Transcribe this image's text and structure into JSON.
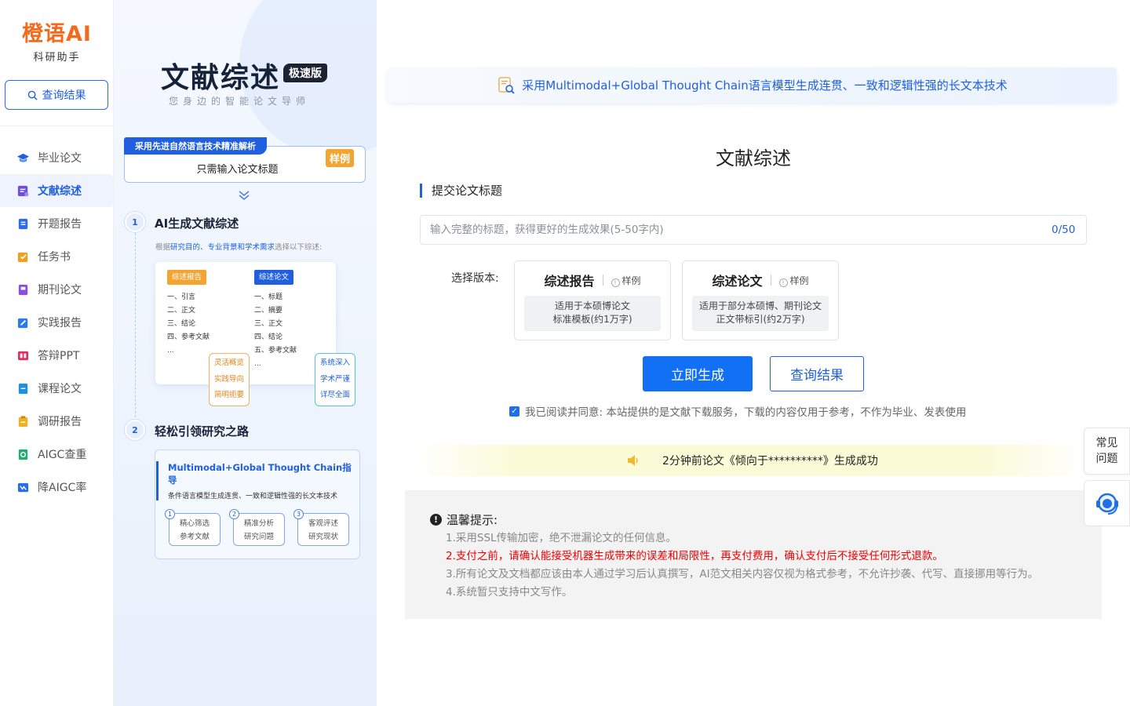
{
  "brand": {
    "name": "橙语AI",
    "tagline": "科研助手"
  },
  "sidebar": {
    "query_label": "查询结果",
    "items": [
      {
        "label": "毕业论文",
        "icon": "graduation-cap-icon",
        "color": "#1f5fe0"
      },
      {
        "label": "文献综述",
        "icon": "document-icon",
        "color": "#6b4fe0",
        "active": true
      },
      {
        "label": "开题报告",
        "icon": "report-icon",
        "color": "#2a6bf0"
      },
      {
        "label": "任务书",
        "icon": "task-icon",
        "color": "#f0a020"
      },
      {
        "label": "期刊论文",
        "icon": "journal-icon",
        "color": "#8a4fe0"
      },
      {
        "label": "实践报告",
        "icon": "practice-icon",
        "color": "#2a7bf0"
      },
      {
        "label": "答辩PPT",
        "icon": "ppt-icon",
        "color": "#e0305f"
      },
      {
        "label": "课程论文",
        "icon": "course-icon",
        "color": "#1f8fe0"
      },
      {
        "label": "调研报告",
        "icon": "survey-icon",
        "color": "#f0b020"
      },
      {
        "label": "AIGC查重",
        "icon": "aigc-check-icon",
        "color": "#1fae70"
      },
      {
        "label": "降AIGC率",
        "icon": "aigc-reduce-icon",
        "color": "#2a6bf0"
      }
    ]
  },
  "promo": {
    "title": "文献综述",
    "badge": "极速版",
    "subtitle": "您身边的智能论文导师",
    "input_tag": "采用先进自然语言技术精准解析",
    "input_text": "只需输入论文标题",
    "sample_tag": "样例",
    "step1": {
      "num": "1",
      "title": "AI生成文献综述",
      "desc_prefix": "根据",
      "desc_highlight": "研究目的、专业背景和学术需求",
      "desc_suffix": "选择以下综述:",
      "left_tag": "综述报告",
      "left_items": [
        "一、引言",
        "二、正文",
        "三、结论",
        "四、参考文献",
        "..."
      ],
      "right_tag": "综述论文",
      "right_items": [
        "一、标题",
        "二、摘要",
        "三、正文",
        "四、结论",
        "五、参考文献",
        "..."
      ],
      "left_features": [
        "灵活概览",
        "实践导向",
        "简明扼要"
      ],
      "right_features": [
        "系统深入",
        "学术严谨",
        "详尽全面"
      ]
    },
    "step2": {
      "num": "2",
      "title": "轻松引领研究之路",
      "card_title": "Multimodal+Global Thought Chain指导",
      "card_sub": "条件语言模型生成连贯、一致和逻辑性强的长文本技术",
      "pills": [
        {
          "num": "1",
          "line1": "精心筛选",
          "line2": "参考文献"
        },
        {
          "num": "2",
          "line1": "精准分析",
          "line2": "研究问题"
        },
        {
          "num": "3",
          "line1": "客观评述",
          "line2": "研究现状"
        }
      ]
    }
  },
  "main": {
    "banner": "采用Multimodal+Global Thought Chain语言模型生成连贯、一致和逻辑性强的长文本技术",
    "title": "文献综述",
    "section_label": "提交论文标题",
    "input_placeholder": "输入完整的标题，获得更好的生成效果(5-50字内)",
    "input_value": "",
    "counter": "0/50",
    "version_label": "选择版本:",
    "versions": [
      {
        "name": "综述报告",
        "sample": "样例",
        "desc1": "适用于本硕博论文",
        "desc2": "标准模板(约1万字)"
      },
      {
        "name": "综述论文",
        "sample": "样例",
        "desc1": "适用于部分本硕博、期刊论文",
        "desc2": "正文带标引(约2万字)"
      }
    ],
    "generate_label": "立即生成",
    "query_label": "查询结果",
    "agree_text": "我已阅读并同意: 本站提供的是文献下载服务，下载的内容仅用于参考，不作为毕业、发表使用",
    "agree_checked": true,
    "notice": "2分钟前论文《倾向于**********》生成成功",
    "tips_title": "温馨提示:",
    "tips": [
      "1.采用SSL传输加密，绝不泄漏论文的任何信息。",
      "2.支付之前，请确认能接受机器生成带来的误差和局限性，再支付费用，确认支付后不接受任何形式退款。",
      "3.所有论文及文档都应该由本人通过学习后认真撰写，AI范文相关内容仅视为格式参考，不允许抄袭、代写、直接挪用等行为。",
      "4.系统暂只支持中文写作。"
    ]
  },
  "float": {
    "faq_line1": "常见",
    "faq_line2": "问题",
    "cs_icon": "customer-service-icon"
  },
  "colors": {
    "primary": "#1f5fe0",
    "brand": "#f26b1d",
    "warning": "#e00",
    "sample": "#f4a531"
  }
}
